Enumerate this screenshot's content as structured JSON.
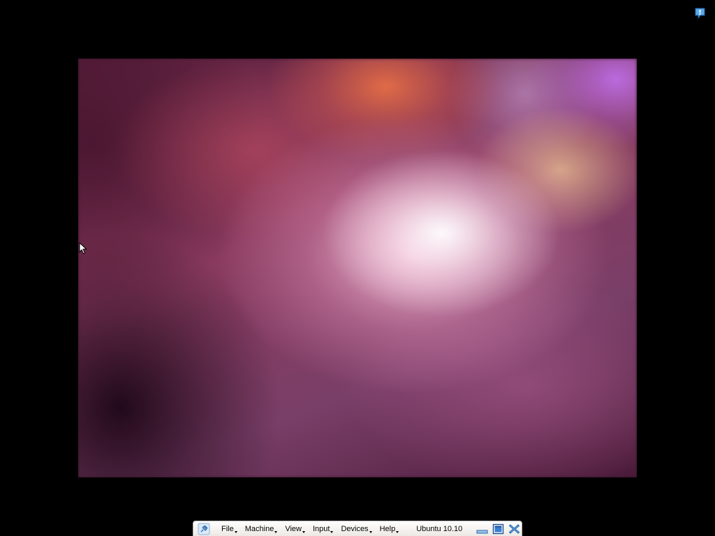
{
  "toolbar": {
    "menus": [
      {
        "label": "File"
      },
      {
        "label": "Machine"
      },
      {
        "label": "View"
      },
      {
        "label": "Input"
      },
      {
        "label": "Devices"
      },
      {
        "label": "Help"
      }
    ],
    "vm_name": "Ubuntu 10.10",
    "pin_icon": "pin-icon",
    "minimize_icon": "minimize-icon",
    "fullscreen_icon": "exit-fullscreen-icon",
    "close_icon": "close-icon"
  },
  "notification": {
    "icon": "info-balloon-icon"
  },
  "colors": {
    "background": "#000000",
    "toolbar": "#ece9e4",
    "accent_blue": "#3a7fd0"
  }
}
